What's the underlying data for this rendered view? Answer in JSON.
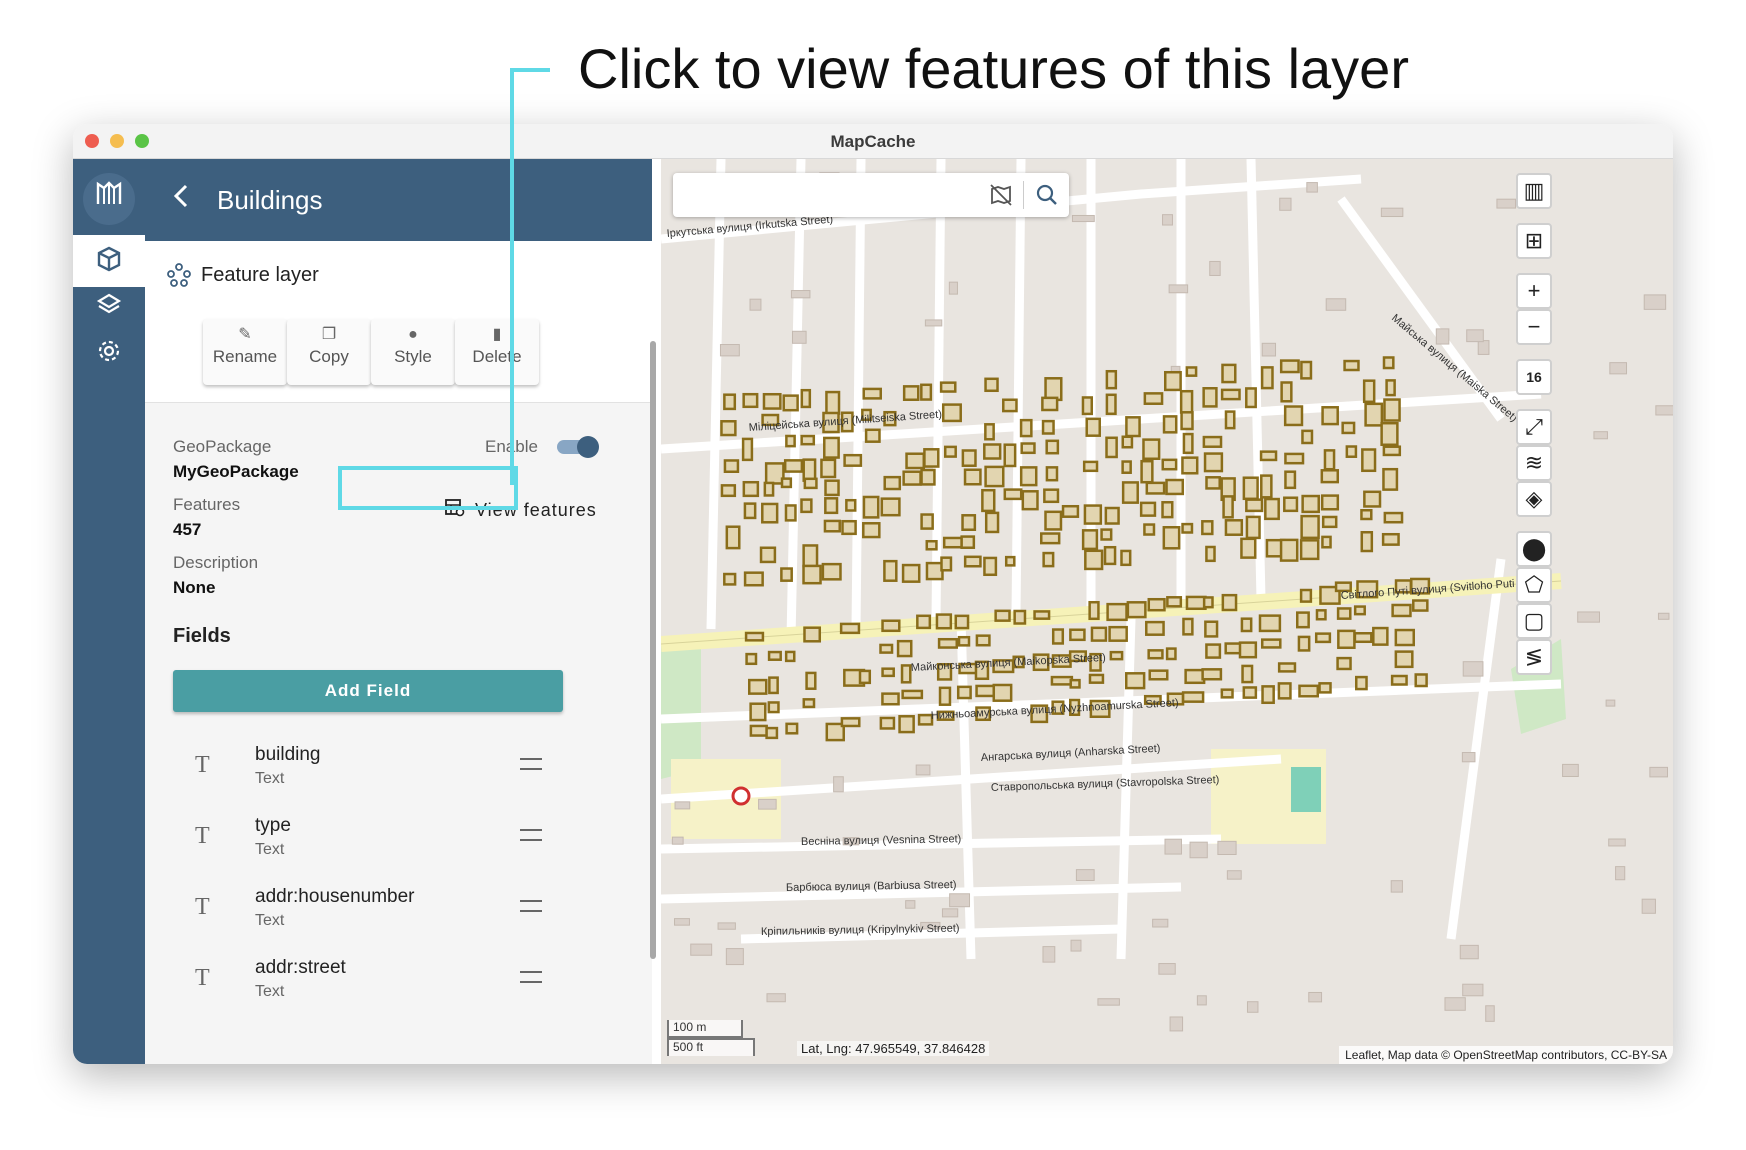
{
  "callout": {
    "text": "Click to view features of this layer",
    "color": "#5fd9e6"
  },
  "window": {
    "title": "MapCache"
  },
  "rail": {
    "logo": "mapcache-logo-icon",
    "items": [
      "feature-cube-icon",
      "layers-icon",
      "settings-gear-icon"
    ]
  },
  "panel": {
    "title": "Buildings",
    "layer_type": "Feature layer",
    "actions": {
      "rename": "Rename",
      "copy": "Copy",
      "style": "Style",
      "delete": "Delete"
    },
    "geopackage_label": "GeoPackage",
    "geopackage_value": "MyGeoPackage",
    "enable_label": "Enable",
    "features_label": "Features",
    "features_value": "457",
    "view_features": "View features",
    "description_label": "Description",
    "description_value": "None",
    "fields_title": "Fields",
    "add_field": "Add Field",
    "fields": [
      {
        "name": "building",
        "type": "Text"
      },
      {
        "name": "type",
        "type": "Text"
      },
      {
        "name": "addr:housenumber",
        "type": "Text"
      },
      {
        "name": "addr:street",
        "type": "Text"
      }
    ]
  },
  "map": {
    "search_placeholder": "",
    "zoom_level": "16",
    "scale_metric": "100 m",
    "scale_imperial": "500 ft",
    "latlng": "Lat, Lng: 47.965549, 37.846428",
    "attribution": "Leaflet, Map data © OpenStreetMap contributors, CC-BY-SA",
    "street_labels": [
      "Іркутська вулиця (Irkutska Street)",
      "Міліцейська вулиця (Militseiska Street)",
      "Світлого Путі вулиця (Svitloho Puti Street)",
      "Майконська вулиця (Maikopska Street)",
      "Нижньоамурська вулиця (Nyzhnoamurska Street)",
      "Ангарська вулиця (Anharska Street)",
      "Ставропольська вулиця (Stavropolska Street)",
      "Весніна вулиця (Vesnina Street)",
      "Барбюса вулиця (Barbiusa Street)",
      "Кріпильників вулиця (Kripylnykiv Street)",
      "Майська вулиця (Maiska Street)"
    ],
    "colors": {
      "building_fill": "#e2d5b0",
      "building_stroke": "#8a6d1a",
      "road_main": "#f6f2b8"
    }
  }
}
